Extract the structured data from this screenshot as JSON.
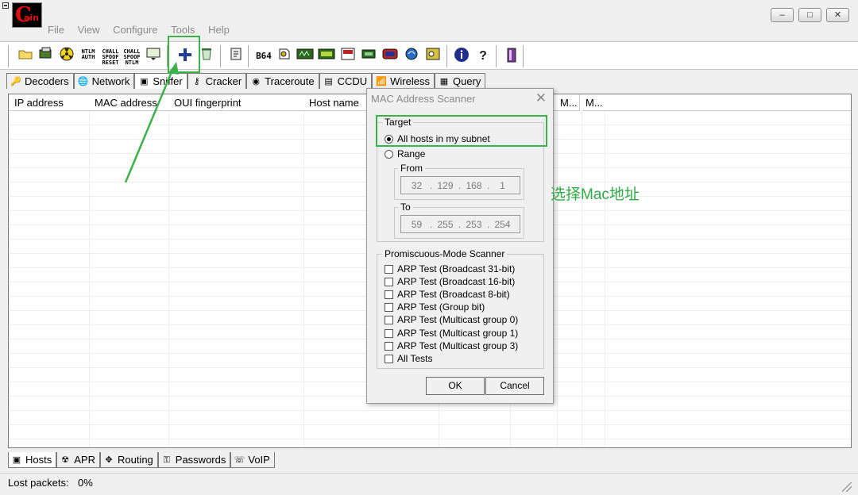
{
  "window": {
    "minimize_glyph": "‒",
    "maximize_glyph": "□",
    "close_glyph": "✕"
  },
  "menu": [
    "File",
    "View",
    "Configure",
    "Tools",
    "Help"
  ],
  "toolbar": {
    "ntlm_auth": "NTLM AUTH",
    "chall_reset": "CHALL SPOOF RESET",
    "chall_ntlm": "CHALL SPOOF NTLM",
    "b64": "B64"
  },
  "tabs_top": [
    "Decoders",
    "Network",
    "Sniffer",
    "Cracker",
    "Traceroute",
    "CCDU",
    "Wireless",
    "Query"
  ],
  "table": {
    "columns": [
      "IP address",
      "MAC address",
      "OUI fingerprint",
      "Host name",
      "M...",
      "M..."
    ]
  },
  "tabs_bottom": [
    "Hosts",
    "APR",
    "Routing",
    "Passwords",
    "VoIP"
  ],
  "status": {
    "label": "Lost packets:",
    "value": "0%"
  },
  "dialog": {
    "title": "MAC Address Scanner",
    "target_group": "Target",
    "all_hosts": "All hosts in my subnet",
    "range": "Range",
    "from_label": "From",
    "from_ip": [
      "32",
      "129",
      "168",
      "1"
    ],
    "to_label": "To",
    "to_ip": [
      "59",
      "255",
      "253",
      "254"
    ],
    "promisc_group": "Promiscuous-Mode Scanner",
    "tests": [
      "ARP Test (Broadcast 31-bit)",
      "ARP Test (Broadcast 16-bit)",
      "ARP Test (Broadcast 8-bit)",
      "ARP Test (Group bit)",
      "ARP Test (Multicast group 0)",
      "ARP Test (Multicast group 1)",
      "ARP Test (Multicast group 3)",
      "All Tests"
    ],
    "ok": "OK",
    "cancel": "Cancel"
  },
  "annotation": {
    "text": "选择Mac地址",
    "color": "#2faa45"
  }
}
